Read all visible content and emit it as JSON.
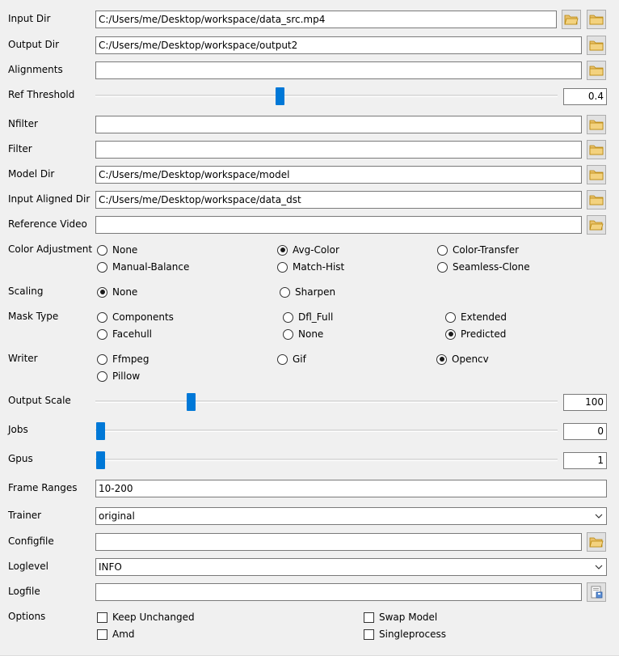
{
  "form": {
    "input_dir": {
      "label": "Input Dir",
      "value": "C:/Users/me/Desktop/workspace/data_src.mp4"
    },
    "output_dir": {
      "label": "Output Dir",
      "value": "C:/Users/me/Desktop/workspace/output2"
    },
    "alignments": {
      "label": "Alignments",
      "value": ""
    },
    "ref_threshold": {
      "label": "Ref Threshold",
      "value": "0.4",
      "slider_fraction": 0.4
    },
    "nfilter": {
      "label": "Nfilter",
      "value": ""
    },
    "filter": {
      "label": "Filter",
      "value": ""
    },
    "model_dir": {
      "label": "Model Dir",
      "value": "C:/Users/me/Desktop/workspace/model"
    },
    "input_aligned_dir": {
      "label": "Input Aligned Dir",
      "value": "C:/Users/me/Desktop/workspace/data_dst"
    },
    "reference_video": {
      "label": "Reference Video",
      "value": ""
    },
    "color_adjustment": {
      "label": "Color Adjustment",
      "options": [
        "None",
        "Avg-Color",
        "Color-Transfer",
        "Manual-Balance",
        "Match-Hist",
        "Seamless-Clone"
      ],
      "selected": "Avg-Color"
    },
    "scaling": {
      "label": "Scaling",
      "options": [
        "None",
        "Sharpen"
      ],
      "selected": "None"
    },
    "mask_type": {
      "label": "Mask Type",
      "options": [
        "Components",
        "Dfl_Full",
        "Extended",
        "Facehull",
        "None",
        "Predicted"
      ],
      "selected": "Predicted"
    },
    "writer": {
      "label": "Writer",
      "options": [
        "Ffmpeg",
        "Gif",
        "Opencv",
        "Pillow"
      ],
      "selected": "Opencv"
    },
    "output_scale": {
      "label": "Output Scale",
      "value": "100"
    },
    "jobs": {
      "label": "Jobs",
      "value": "0"
    },
    "gpus": {
      "label": "Gpus",
      "value": "1"
    },
    "frame_ranges": {
      "label": "Frame Ranges",
      "value": "10-200"
    },
    "trainer": {
      "label": "Trainer",
      "value": "original"
    },
    "configfile": {
      "label": "Configfile",
      "value": ""
    },
    "loglevel": {
      "label": "Loglevel",
      "value": "INFO"
    },
    "logfile": {
      "label": "Logfile",
      "value": ""
    },
    "options": {
      "label": "Options",
      "items": [
        "Keep Unchanged",
        "Swap Model",
        "Amd",
        "Singleprocess"
      ],
      "checked": []
    }
  },
  "colors": {
    "background": "#f0f0f0",
    "slider_accent": "#0078d7",
    "folder_icon": "#e8c06a"
  },
  "icons": {
    "browse_folder": "folder-icon",
    "browse_file": "folder-open-icon",
    "save_file": "save-file-icon",
    "dropdown": "chevron-down-icon"
  }
}
